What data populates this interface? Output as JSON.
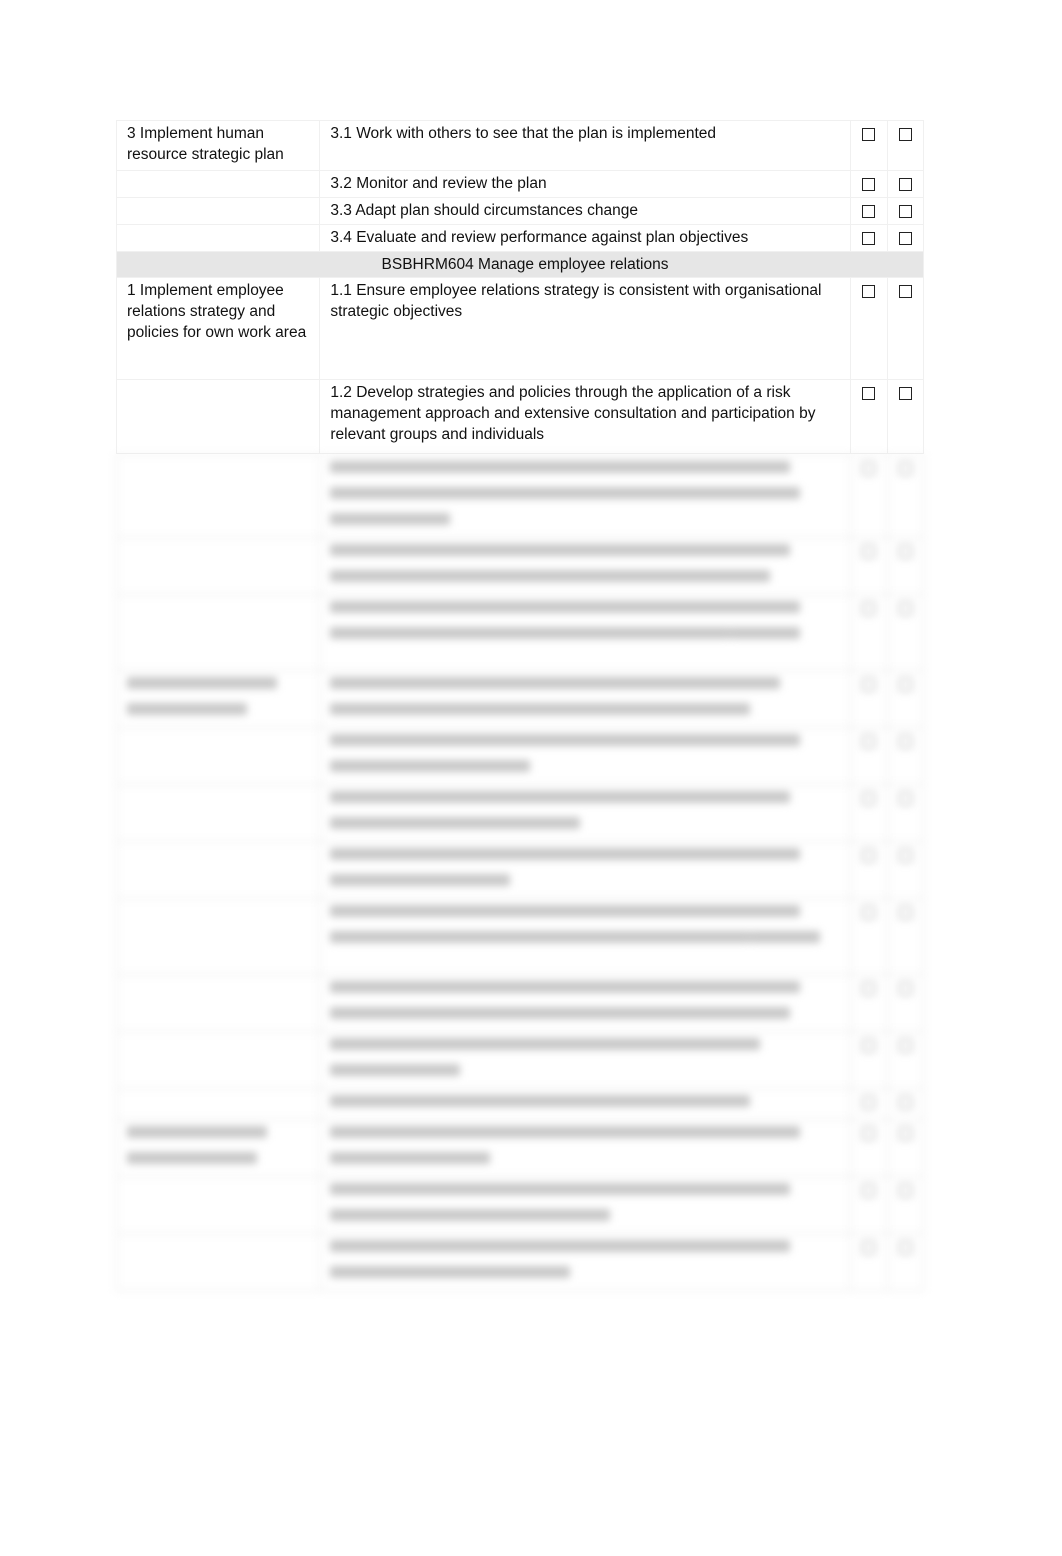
{
  "document": {
    "rows_top": [
      {
        "element": "3 Implement human resource strategic plan",
        "criteria": "3.1 Work with others to see that the plan is implemented"
      },
      {
        "element": "",
        "criteria": "3.2 Monitor and review the plan"
      },
      {
        "element": "",
        "criteria": "3.3 Adapt plan should circumstances change"
      },
      {
        "element": "",
        "criteria": "3.4 Evaluate and review performance against plan objectives"
      }
    ],
    "section_heading": "BSBHRM604 Manage employee relations",
    "rows_section": [
      {
        "element": "1 Implement employee relations strategy and policies for own work area",
        "criteria": "1.1 Ensure employee relations strategy is consistent with organisational strategic objectives"
      },
      {
        "element": "",
        "criteria": "1.2 Develop strategies and policies through the application of a risk management approach and extensive consultation and participation by relevant groups and individuals"
      }
    ],
    "blurred_note": "Remaining rows are blurred and unreadable"
  }
}
